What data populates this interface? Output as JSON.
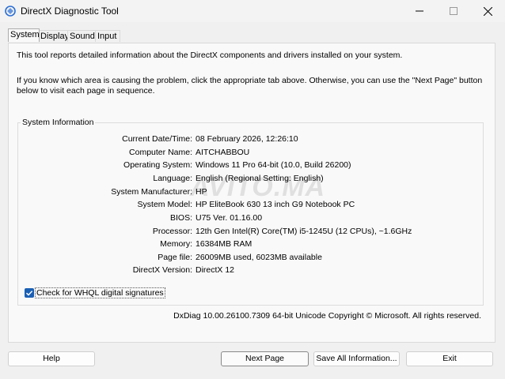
{
  "window": {
    "title": "DirectX Diagnostic Tool"
  },
  "tabs": [
    {
      "label": "System",
      "active": true
    },
    {
      "label": "Display",
      "active": false
    },
    {
      "label": "Sound",
      "active": false
    },
    {
      "label": "Input",
      "active": false
    }
  ],
  "intro": {
    "line1": "This tool reports detailed information about the DirectX components and drivers installed on your system.",
    "line2": "If you know which area is causing the problem, click the appropriate tab above.  Otherwise, you can use the \"Next Page\" button below to visit each page in sequence."
  },
  "system_info": {
    "title": "System Information",
    "rows": [
      {
        "label": "Current Date/Time:",
        "value": "08 February 2026, 12:26:10"
      },
      {
        "label": "Computer Name:",
        "value": "AITCHABBOU"
      },
      {
        "label": "Operating System:",
        "value": "Windows 11 Pro 64-bit (10.0, Build 26200)"
      },
      {
        "label": "Language:",
        "value": "English (Regional Setting: English)"
      },
      {
        "label": "System Manufacturer:",
        "value": "HP"
      },
      {
        "label": "System Model:",
        "value": "HP EliteBook 630 13 inch G9 Notebook PC"
      },
      {
        "label": "BIOS:",
        "value": "U75 Ver. 01.16.00"
      },
      {
        "label": "Processor:",
        "value": "12th Gen Intel(R) Core(TM) i5-1245U (12 CPUs), ~1.6GHz"
      },
      {
        "label": "Memory:",
        "value": "16384MB RAM"
      },
      {
        "label": "Page file:",
        "value": "26009MB used, 6023MB available"
      },
      {
        "label": "DirectX Version:",
        "value": "DirectX 12"
      }
    ]
  },
  "whql": {
    "label": "Check for WHQL digital signatures",
    "checked": true
  },
  "copyright": "DxDiag 10.00.26100.7309 64-bit Unicode  Copyright © Microsoft. All rights reserved.",
  "watermark": "AVITO.MA",
  "buttons": {
    "help": "Help",
    "next_page": "Next Page",
    "save_all": "Save All Information...",
    "exit": "Exit"
  },
  "colors": {
    "checkbox_accent": "#1a5fb4",
    "icon_accent": "#2a6fd6"
  }
}
